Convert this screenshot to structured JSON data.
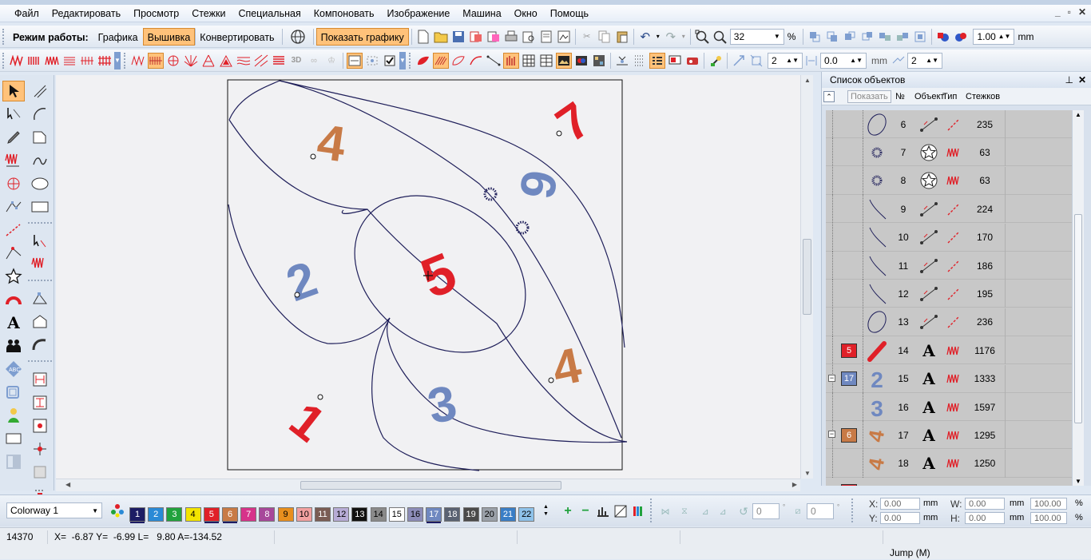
{
  "menu": [
    "Файл",
    "Редактировать",
    "Просмотр",
    "Стежки",
    "Специальная",
    "Компоновать",
    "Изображение",
    "Машина",
    "Окно",
    "Помощь"
  ],
  "window_controls": [
    "_",
    "▫",
    "✕"
  ],
  "toolbar1": {
    "mode_label": "Режим работы:",
    "mode_graphics": "Графика",
    "mode_embroidery": "Вышивка",
    "mode_convert": "Конвертировать",
    "show_graphics": "Показать графику",
    "zoom_value": "32",
    "zoom_unit": "%",
    "width_value": "1.00",
    "width_unit": "mm"
  },
  "toolbar2": {
    "spin1": "2",
    "spin2": "0.0",
    "spin2_unit": "mm",
    "spin3": "2"
  },
  "canvas": {
    "numerals": [
      {
        "text": "7",
        "color": "#e02028"
      },
      {
        "text": "4",
        "color": "#c87a46"
      },
      {
        "text": "6",
        "color": "#6f88c0"
      },
      {
        "text": "2",
        "color": "#6f88c0"
      },
      {
        "text": "5",
        "color": "#e02028"
      },
      {
        "text": "4",
        "color": "#c87a46"
      },
      {
        "text": "3",
        "color": "#6f88c0"
      },
      {
        "text": "1",
        "color": "#e02028"
      }
    ]
  },
  "panel": {
    "title": "Список объектов",
    "show_button": "Показать",
    "columns": {
      "no": "№",
      "object": "Объект",
      "type": "Тип",
      "stitches": "Стежков"
    },
    "rows": [
      {
        "color_num": "",
        "color": "",
        "no": "6",
        "kind": "curve",
        "type": "run",
        "stitches": "235"
      },
      {
        "color_num": "",
        "color": "",
        "no": "7",
        "kind": "star",
        "type": "zigzag",
        "stitches": "63"
      },
      {
        "color_num": "",
        "color": "",
        "no": "8",
        "kind": "star",
        "type": "zigzag",
        "stitches": "63"
      },
      {
        "color_num": "",
        "color": "",
        "no": "9",
        "kind": "curve",
        "type": "run",
        "stitches": "224"
      },
      {
        "color_num": "",
        "color": "",
        "no": "10",
        "kind": "curve",
        "type": "run",
        "stitches": "170"
      },
      {
        "color_num": "",
        "color": "",
        "no": "11",
        "kind": "curve",
        "type": "run",
        "stitches": "186"
      },
      {
        "color_num": "",
        "color": "",
        "no": "12",
        "kind": "curve",
        "type": "run",
        "stitches": "195"
      },
      {
        "color_num": "",
        "color": "",
        "no": "13",
        "kind": "curve",
        "type": "run",
        "stitches": "236"
      },
      {
        "color_num": "5",
        "color": "#e02028",
        "no": "14",
        "kind": "text",
        "type": "zigzag",
        "stitches": "1176"
      },
      {
        "color_num": "17",
        "color": "#6f88c0",
        "no": "15",
        "kind": "text",
        "type": "zigzag",
        "stitches": "1333"
      },
      {
        "color_num": "",
        "color": "",
        "no": "16",
        "kind": "text",
        "type": "zigzag",
        "stitches": "1597"
      },
      {
        "color_num": "6",
        "color": "#c87a46",
        "no": "17",
        "kind": "text",
        "type": "zigzag",
        "stitches": "1295"
      },
      {
        "color_num": "",
        "color": "",
        "no": "18",
        "kind": "text",
        "type": "zigzag",
        "stitches": "1250"
      }
    ]
  },
  "colorway": {
    "label": "Colorway 1",
    "swatches": [
      {
        "n": "1",
        "c": "#1c1c64"
      },
      {
        "n": "2",
        "c": "#2a8ad6"
      },
      {
        "n": "3",
        "c": "#21a23d"
      },
      {
        "n": "4",
        "c": "#f2e400"
      },
      {
        "n": "5",
        "c": "#e02028"
      },
      {
        "n": "6",
        "c": "#c87a46"
      },
      {
        "n": "7",
        "c": "#d6338a"
      },
      {
        "n": "8",
        "c": "#a7489a"
      },
      {
        "n": "9",
        "c": "#e88f1e"
      },
      {
        "n": "10",
        "c": "#f2a0a0"
      },
      {
        "n": "11",
        "c": "#7a5c54"
      },
      {
        "n": "12",
        "c": "#b7acd6"
      },
      {
        "n": "13",
        "c": "#111111"
      },
      {
        "n": "14",
        "c": "#8a8a8a"
      },
      {
        "n": "15",
        "c": "#ffffff"
      },
      {
        "n": "16",
        "c": "#8c8cb8"
      },
      {
        "n": "17",
        "c": "#6f88c0"
      },
      {
        "n": "18",
        "c": "#5a6272"
      },
      {
        "n": "19",
        "c": "#4a4a4a"
      },
      {
        "n": "20",
        "c": "#9aa0a8"
      },
      {
        "n": "21",
        "c": "#3a7ec6"
      },
      {
        "n": "22",
        "c": "#8ec2ea"
      }
    ],
    "rotate_value": "0",
    "slant_value": "0"
  },
  "coords": {
    "x_label": "X:",
    "x_value": "0.00",
    "y_label": "Y:",
    "y_value": "0.00",
    "w_label": "W:",
    "w_value": "0.00",
    "h_label": "H:",
    "h_value": "0.00",
    "unit": "mm",
    "pw_value": "100.00",
    "ph_value": "100.00",
    "pct": "%"
  },
  "status": {
    "stitch_count": "14370",
    "position": "X=  -6.87 Y=  -6.99 L=   9.80 A=-134.52",
    "mode": "Jump (M)"
  }
}
